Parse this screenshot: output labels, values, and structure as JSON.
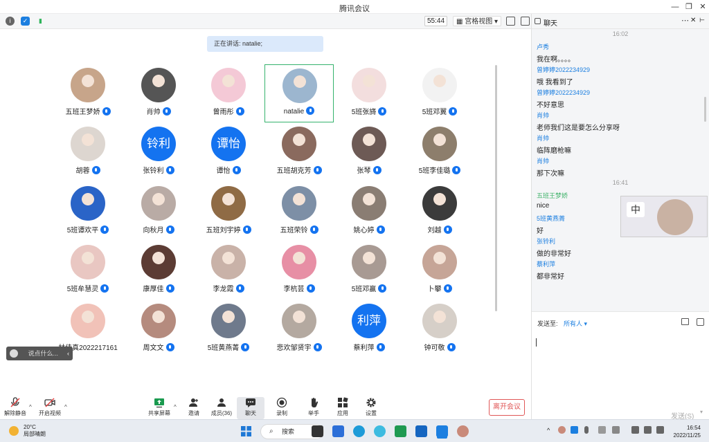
{
  "window": {
    "title": "腾讯会议"
  },
  "toolbar": {
    "timer": "55:44",
    "view_label": "宫格视图 ▾"
  },
  "speaking": {
    "label": "正在讲话: natalie;"
  },
  "participants": [
    {
      "name": "五班王梦娇",
      "avatar": "photo",
      "color": "#c7a58a"
    },
    {
      "name": "肖帅",
      "avatar": "photo",
      "color": "#555"
    },
    {
      "name": "曾雨彤",
      "avatar": "photo",
      "color": "#f4c9d6"
    },
    {
      "name": "natalie",
      "avatar": "photo",
      "color": "#9cb6cf"
    },
    {
      "name": "5班张旖",
      "avatar": "photo",
      "color": "#f3dede"
    },
    {
      "name": "5班邓翼",
      "avatar": "photo",
      "color": "#f2f2f2"
    },
    {
      "name": "胡蓉",
      "avatar": "photo",
      "color": "#ddd6d0"
    },
    {
      "name": "张铃利",
      "avatar": "text",
      "text": "铃利"
    },
    {
      "name": "谭怡",
      "avatar": "text",
      "text": "谭怡"
    },
    {
      "name": "五班胡克芳",
      "avatar": "photo",
      "color": "#8a6a5e"
    },
    {
      "name": "张琴",
      "avatar": "photo",
      "color": "#6d5a55"
    },
    {
      "name": "5班李佳璐",
      "avatar": "photo",
      "color": "#8d7e6c"
    },
    {
      "name": "5班谭欢平",
      "avatar": "photo",
      "color": "#2a64c7"
    },
    {
      "name": "向秋月",
      "avatar": "photo",
      "color": "#b9aba5"
    },
    {
      "name": "五班刘宇婷",
      "avatar": "photo",
      "color": "#8f6b45"
    },
    {
      "name": "五班荣铃",
      "avatar": "photo",
      "color": "#7d8fa6"
    },
    {
      "name": "姚心婷",
      "avatar": "photo",
      "color": "#8a7d73"
    },
    {
      "name": "刘越",
      "avatar": "photo",
      "color": "#3b3b3b"
    },
    {
      "name": "5班牟慧灵",
      "avatar": "photo",
      "color": "#e9c7c2"
    },
    {
      "name": "康厚佳",
      "avatar": "photo",
      "color": "#5c3c34"
    },
    {
      "name": "李龙霞",
      "avatar": "photo",
      "color": "#c9b2a8"
    },
    {
      "name": "李杭芸",
      "avatar": "photo",
      "color": "#e78fa5"
    },
    {
      "name": "5班邓赢",
      "avatar": "photo",
      "color": "#a89a93"
    },
    {
      "name": "卜攀",
      "avatar": "photo",
      "color": "#c6a597"
    },
    {
      "name": "林佳真2022217161",
      "avatar": "photo",
      "color": "#f1c2b8",
      "no_mic": true
    },
    {
      "name": "周文文",
      "avatar": "photo",
      "color": "#b58b7e"
    },
    {
      "name": "5班黄燕菁",
      "avatar": "photo",
      "color": "#6f7a8c"
    },
    {
      "name": "悲欢邹贤宇",
      "avatar": "photo",
      "color": "#b4a9a0"
    },
    {
      "name": "蔡利萍",
      "avatar": "text",
      "text": "利萍"
    },
    {
      "name": "钟可敬",
      "avatar": "photo",
      "color": "#d6cfc8"
    }
  ],
  "say_something": {
    "placeholder": "说点什么..."
  },
  "bottom": {
    "unmute": "解除静音",
    "video": "开启视频",
    "share": "共享屏幕",
    "invite": "邀请",
    "members": "成员(36)",
    "chat": "聊天",
    "record": "录制",
    "hand": "举手",
    "apps": "应用",
    "settings": "设置",
    "leave": "离开会议"
  },
  "chat": {
    "title": "聊天",
    "messages": [
      {
        "type": "time",
        "text": "16:02"
      },
      {
        "type": "who",
        "text": "卢秀"
      },
      {
        "type": "text",
        "text": "我在啊。。。。"
      },
      {
        "type": "who",
        "text": "曾婷婷2022234929"
      },
      {
        "type": "text",
        "text": "哦 我看到了"
      },
      {
        "type": "who",
        "text": "曾婷婷2022234929"
      },
      {
        "type": "text",
        "text": "不好意思"
      },
      {
        "type": "who",
        "text": "肖帅"
      },
      {
        "type": "text",
        "text": "老师我们这是要怎么分享呀"
      },
      {
        "type": "who",
        "text": "肖帅"
      },
      {
        "type": "text",
        "text": "临阵磨枪嘛"
      },
      {
        "type": "who",
        "text": "肖帅"
      },
      {
        "type": "text",
        "text": "那下次嘛"
      },
      {
        "type": "time",
        "text": "16:41"
      },
      {
        "type": "who-green",
        "text": "五班王梦娇"
      },
      {
        "type": "text",
        "text": "nice"
      },
      {
        "type": "who",
        "text": "5班黄燕菁"
      },
      {
        "type": "text",
        "text": "好"
      },
      {
        "type": "who",
        "text": "张铃利"
      },
      {
        "type": "text",
        "text": "做的非常好"
      },
      {
        "type": "who",
        "text": "蔡利萍"
      },
      {
        "type": "text",
        "text": "都非常好"
      }
    ],
    "send_to_label": "发送至:",
    "send_to_value": "所有人 ▾",
    "send_button": "发送(S)"
  },
  "taskbar": {
    "temp": "20°C",
    "weather": "局部晴朗",
    "search": "搜索",
    "time": "16:54",
    "date": "2022/11/25"
  }
}
